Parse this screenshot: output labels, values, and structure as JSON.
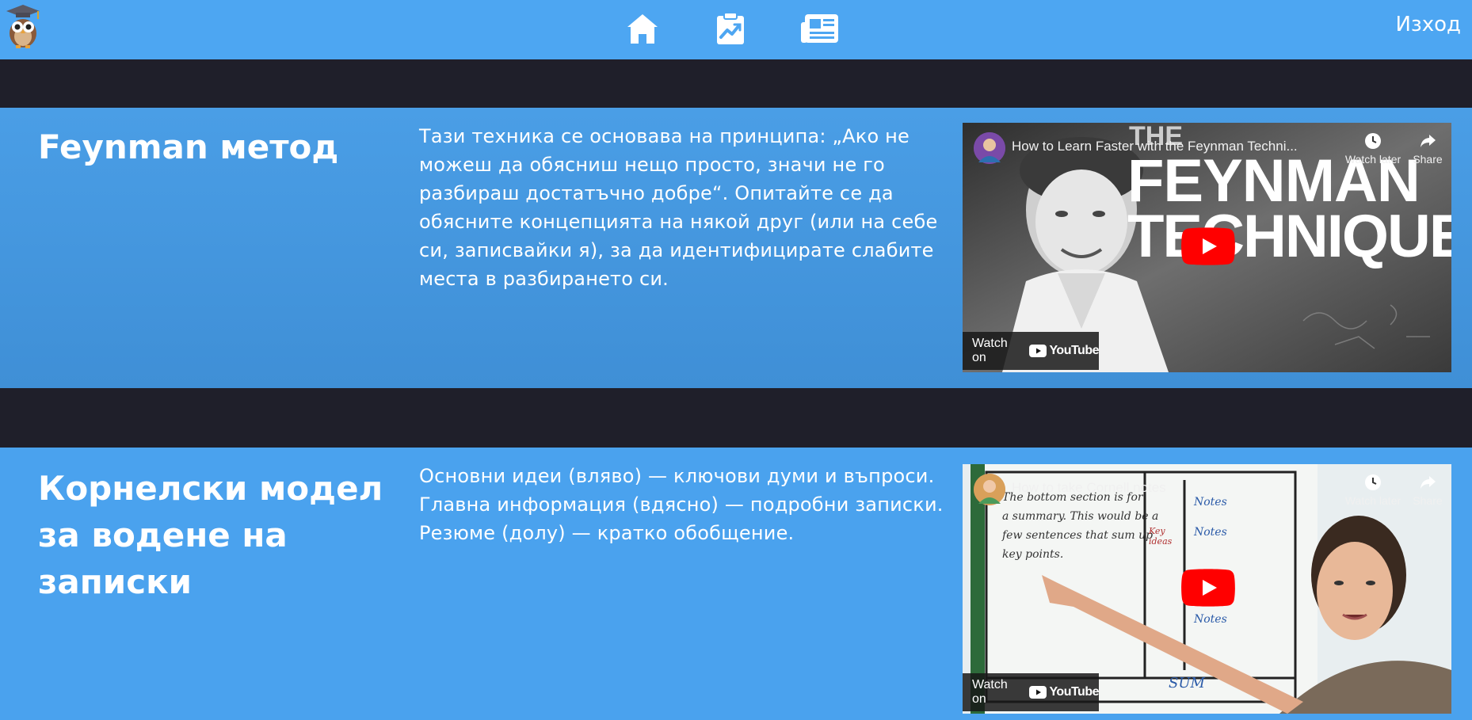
{
  "header": {
    "logout_label": "Изход",
    "nav": [
      "home-icon",
      "clipboard-chart-icon",
      "news-icon"
    ]
  },
  "sections": [
    {
      "title": "Feynman метод",
      "text": "Тази техника се основава на принципа: „Ако не можеш да обясниш нещо просто, значи не го разбираш достатъчно добре“. Опитайте се да обясните концепцията на някой друг (или на себе си, записвайки я), за да идентифицирате слабите места в разбирането си.",
      "video": {
        "title": "How to Learn Faster with the Feynman Techni...",
        "watch_later": "Watch later",
        "share": "Share",
        "watch_on": "Watch on",
        "youtube": "YouTube",
        "thumbnail_text_1": "THE",
        "thumbnail_text_2": "FEYNMAN",
        "thumbnail_text_3": "TECHNIQUE"
      }
    },
    {
      "title": "Корнелски модел за водене на записки",
      "lines": [
        "Основни идеи (вляво) — ключови думи и въпроси.",
        "Главна информация (вдясно) — подробни записки.",
        "Резюме (долу) — кратко обобщение."
      ],
      "video": {
        "title": "How to take Cornell notes",
        "watch_later": "Watch later",
        "share": "Share",
        "watch_on": "Watch on",
        "youtube": "YouTube",
        "board_text": [
          "The bottom section is for",
          "a summary. This would be a",
          "few sentences that sum up",
          "key points.",
          "Notes",
          "Notes",
          "Notes",
          "Key ideas",
          "SUM"
        ]
      }
    }
  ],
  "colors": {
    "topbar": "#4da6f2",
    "dark_band": "#1f1f2a",
    "section_1": "#4398e2",
    "section_2": "#4aa2ee",
    "yt_red": "#ff0000"
  }
}
